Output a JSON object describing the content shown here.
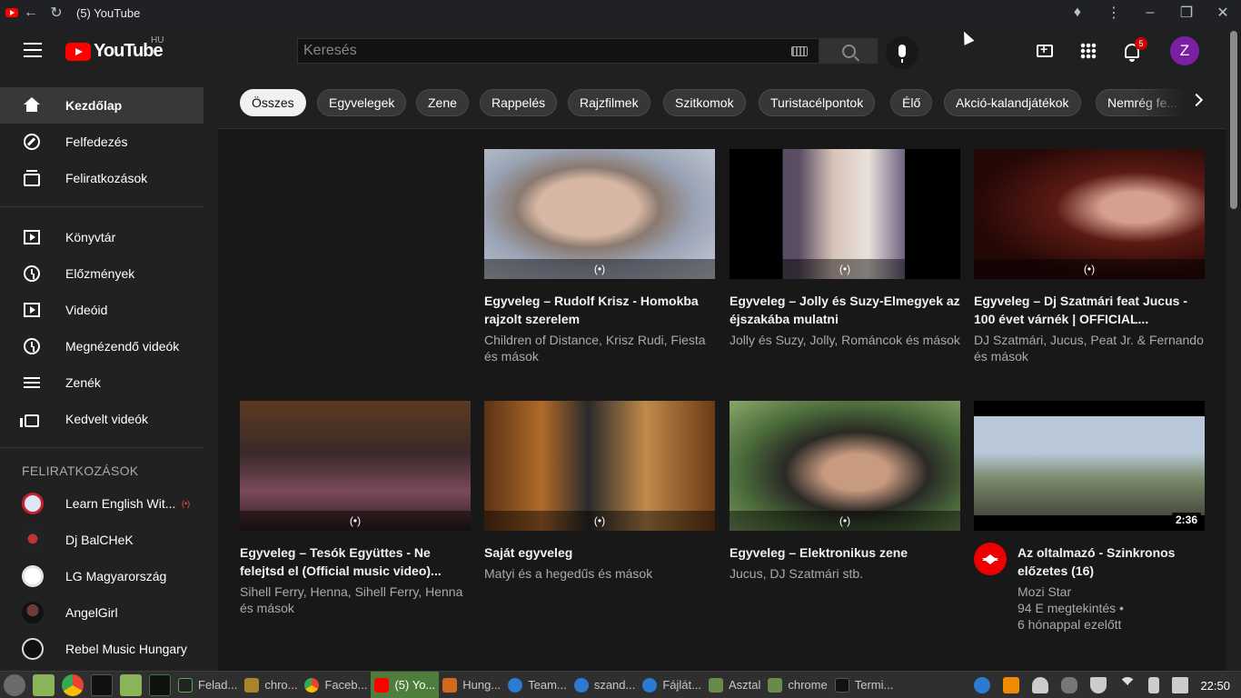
{
  "browser": {
    "tab_title": "(5) YouTube"
  },
  "masthead": {
    "logo_text": "YouTube",
    "country": "HU",
    "search_placeholder": "Keresés",
    "notification_count": "5",
    "avatar_letter": "Z"
  },
  "sidebar": {
    "main": [
      {
        "label": "Kezdőlap",
        "icon": "home-icon"
      },
      {
        "label": "Felfedezés",
        "icon": "compass-icon"
      },
      {
        "label": "Feliratkozások",
        "icon": "subscriptions-icon"
      }
    ],
    "library": [
      {
        "label": "Könyvtár",
        "icon": "library-icon"
      },
      {
        "label": "Előzmények",
        "icon": "history-icon"
      },
      {
        "label": "Videóid",
        "icon": "your-videos-icon"
      },
      {
        "label": "Megnézendő videók",
        "icon": "watch-later-icon"
      },
      {
        "label": "Zenék",
        "icon": "music-playlist-icon"
      },
      {
        "label": "Kedvelt videók",
        "icon": "liked-videos-icon"
      }
    ],
    "subs_heading": "FELIRATKOZÁSOK",
    "subscriptions": [
      {
        "label": "Learn English Wit..."
      },
      {
        "label": "Dj BalCHeK"
      },
      {
        "label": "LG Magyarország"
      },
      {
        "label": "AngelGirl"
      },
      {
        "label": "Rebel Music Hungary"
      }
    ]
  },
  "chips": [
    "Összes",
    "Egyvelegek",
    "Zene",
    "Rappelés",
    "Rajzfilmek",
    "Szitkomok",
    "Turistacélpontok",
    "Élő",
    "Akció-kalandjátékok",
    "Nemrég fe..."
  ],
  "videos": [
    {
      "title": "Egyveleg – Rudolf Krisz - Homokba rajzolt szerelem",
      "meta": "Children of Distance, Krisz Rudi, Fiesta és mások",
      "mix": "(•)"
    },
    {
      "title": "Egyveleg – Jolly és Suzy-Elmegyek az éjszakába mulatni",
      "meta": "Jolly és Suzy, Jolly, Románcok és mások",
      "mix": "(•)"
    },
    {
      "title": "Egyveleg – Dj Szatmári feat Jucus - 100 évet várnék | OFFICIAL...",
      "meta": "DJ Szatmári, Jucus, Peat Jr. & Fernando és mások",
      "mix": "(•)"
    },
    {
      "title": "Egyveleg – Tesók Együttes - Ne felejtsd el (Official music video)...",
      "meta": "Sihell Ferry, Henna, Sihell Ferry, Henna és mások",
      "mix": "(•)"
    },
    {
      "title": "Saját egyveleg",
      "meta": "Matyi és a hegedűs és mások",
      "mix": "(•)"
    },
    {
      "title": "Egyveleg – Elektronikus zene",
      "meta": "Jucus, DJ Szatmári stb.",
      "mix": "(•)"
    },
    {
      "title": "Az oltalmazó - Szinkronos előzetes (16)",
      "channel": "Mozi Star",
      "views": "94 E megtekintés •",
      "age": "6 hónappal ezelőtt",
      "duration": "2:36"
    }
  ],
  "taskbar": {
    "apps": [
      "Felad...",
      "chro...",
      "Faceb...",
      "(5) Yo...",
      "Hung...",
      "Team...",
      "szand...",
      "Fájlát...",
      "Asztal",
      "chrome",
      "Termi..."
    ],
    "clock": "22:50"
  },
  "colors": {
    "brand_red": "#ff0000",
    "background": "#181818",
    "taskbar_active": "#4f7d3b"
  }
}
